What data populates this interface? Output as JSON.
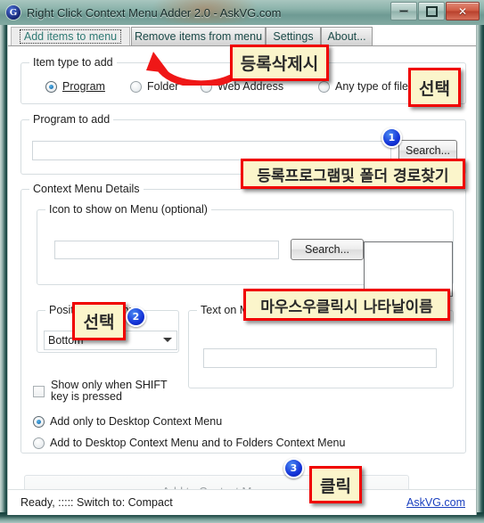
{
  "window": {
    "title": "Right Click Context Menu Adder 2.0  -  AskVG.com",
    "app_icon": "G",
    "controls": {
      "minimize": "minimize-icon",
      "maximize": "maximize-icon",
      "close": "✕"
    }
  },
  "tabs": [
    {
      "label": "Add items to menu",
      "active": true
    },
    {
      "label": "Remove items from menu",
      "active": false
    },
    {
      "label": "Settings",
      "active": false
    },
    {
      "label": "About...",
      "active": false
    }
  ],
  "item_type_group": {
    "legend": "Item type to add",
    "options": [
      {
        "label": "Program",
        "selected": true
      },
      {
        "label": "Folder",
        "selected": false
      },
      {
        "label": "Web Address",
        "selected": false
      },
      {
        "label": "Any type of file",
        "selected": false
      }
    ]
  },
  "program_group": {
    "legend": "Program to add",
    "path_value": "",
    "search_button": "Search..."
  },
  "context_menu_details": {
    "legend": "Context Menu Details",
    "icon_group": {
      "legend": "Icon to show on Menu (optional)",
      "icon_path_value": "",
      "search_button": "Search..."
    },
    "position_group": {
      "legend": "Position on Menu",
      "selected": "Bottom"
    },
    "text_group": {
      "legend": "Text on Menu",
      "value": ""
    },
    "shift_checkbox": {
      "line1": "Show only when SHIFT",
      "line2": "key is pressed",
      "checked": false
    },
    "scope_options": [
      {
        "label": "Add only to Desktop Context Menu",
        "selected": true
      },
      {
        "label": "Add to Desktop Context Menu and to Folders Context Menu",
        "selected": false
      }
    ]
  },
  "action_button": {
    "label": "Add to Context Menu"
  },
  "status_bar": {
    "text": "Ready,  :::::  Switch to: Compact",
    "link": "AskVG.com"
  },
  "annotations": {
    "note_tabs": "등록삭제시",
    "note_select_type": "선택",
    "note_program_path": "등록프로그램및 폴더 경로찾기",
    "note_select_position": "선택",
    "note_menu_text": "마우스우클릭시 나타날이름",
    "note_click": "클릭",
    "badge_1": "1",
    "badge_2": "2",
    "badge_3": "3"
  },
  "colors": {
    "annotation_fill": "#fbf5cb",
    "annotation_border": "#f00000",
    "badge_blue": "#1433d8",
    "link_blue": "#1a3fbf",
    "frame_teal": "#14403c"
  }
}
